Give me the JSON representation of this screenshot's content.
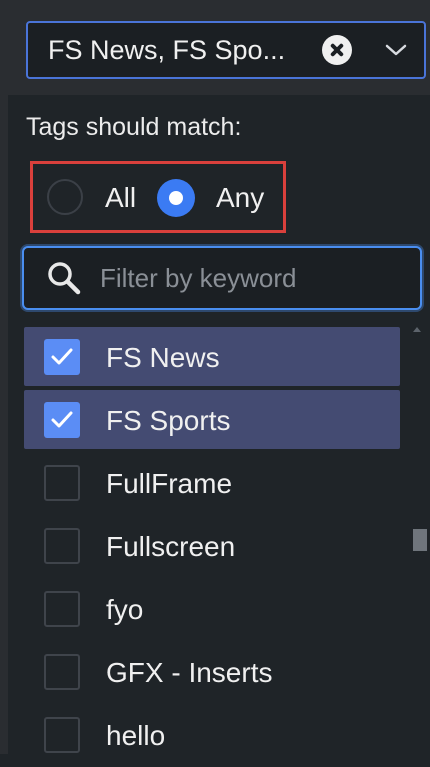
{
  "dropdown": {
    "selected_text": "FS News, FS Spo...",
    "icons": {
      "clear": "close-circle-icon",
      "toggle": "chevron-down-icon"
    }
  },
  "match": {
    "label": "Tags should match:",
    "options": [
      {
        "label": "All",
        "selected": false
      },
      {
        "label": "Any",
        "selected": true
      }
    ]
  },
  "filter": {
    "placeholder": "Filter by keyword",
    "value": "",
    "icon": "search-icon"
  },
  "tags": [
    {
      "label": "FS News",
      "checked": true
    },
    {
      "label": "FS Sports",
      "checked": true
    },
    {
      "label": "FullFrame",
      "checked": false
    },
    {
      "label": "Fullscreen",
      "checked": false
    },
    {
      "label": "fyo",
      "checked": false
    },
    {
      "label": "GFX - Inserts",
      "checked": false
    },
    {
      "label": "hello",
      "checked": false
    }
  ],
  "colors": {
    "accent": "#3b7bf3",
    "selected_row": "#444b72",
    "highlight_border": "#d9403c",
    "background": "#1f2428"
  }
}
